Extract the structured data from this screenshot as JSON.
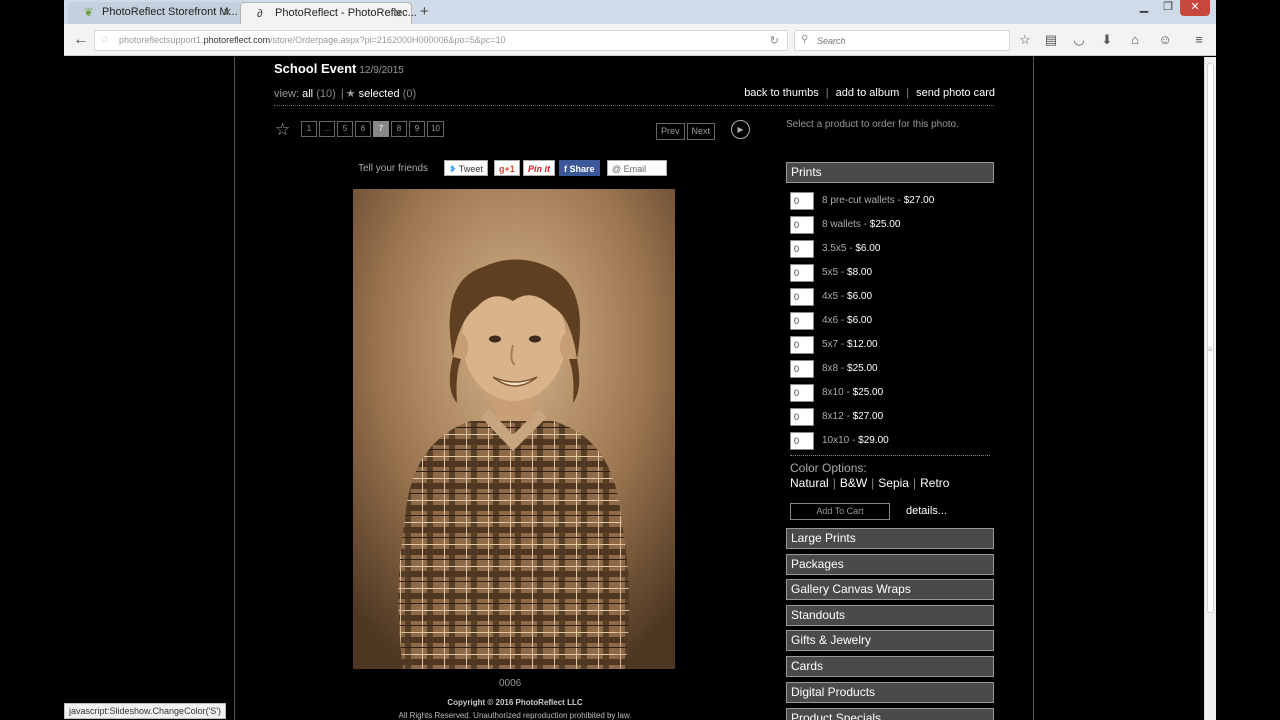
{
  "browser": {
    "tabs": [
      {
        "title": "PhotoReflect Storefront M...",
        "active": false
      },
      {
        "title": "PhotoReflect - PhotoReflec...",
        "active": true
      }
    ],
    "url_prefix": "photoreflectsupport1.",
    "url_domain": "photoreflect.com",
    "url_path": "/store/Orderpage.aspx?pi=2162000H000006&po=5&pc=10",
    "search_placeholder": "Search",
    "status_text": "javascript:Slideshow.ChangeColor('S')"
  },
  "event": {
    "title": "School Event",
    "date": "12/9/2015"
  },
  "view": {
    "label": "view:",
    "all_label": "all",
    "all_count": "(10)",
    "selected_label": "selected",
    "selected_count": "(0)"
  },
  "top_links": {
    "back": "back to thumbs",
    "album": "add to album",
    "card": "send photo card"
  },
  "pager": {
    "pages": [
      "1",
      "...",
      "5",
      "6",
      "7",
      "8",
      "9",
      "10"
    ],
    "current": "7",
    "prev": "Prev",
    "next": "Next"
  },
  "select_message": "Select a product to order for this photo.",
  "share": {
    "tell_label": "Tell your friends",
    "tweet": "Tweet",
    "gplus": "g+1",
    "pin": "Pin it",
    "fb_share": "Share",
    "email": "@ Email"
  },
  "photo": {
    "number": "0006"
  },
  "footer": {
    "copyright": "Copyright © 2016 PhotoReflect LLC",
    "rights": "All Rights Reserved. Unauthorized reproduction prohibited by law."
  },
  "prints": {
    "header": "Prints",
    "items": [
      {
        "qty": "0",
        "name": "8 pre-cut wallets",
        "price": "$27.00"
      },
      {
        "qty": "0",
        "name": "8 wallets",
        "price": "$25.00"
      },
      {
        "qty": "0",
        "name": "3.5x5",
        "price": "$6.00"
      },
      {
        "qty": "0",
        "name": "5x5",
        "price": "$8.00"
      },
      {
        "qty": "0",
        "name": "4x5",
        "price": "$6.00"
      },
      {
        "qty": "0",
        "name": "4x6",
        "price": "$6.00"
      },
      {
        "qty": "0",
        "name": "5x7",
        "price": "$12.00"
      },
      {
        "qty": "0",
        "name": "8x8",
        "price": "$25.00"
      },
      {
        "qty": "0",
        "name": "8x10",
        "price": "$25.00"
      },
      {
        "qty": "0",
        "name": "8x12",
        "price": "$27.00"
      },
      {
        "qty": "0",
        "name": "10x10",
        "price": "$29.00"
      }
    ],
    "color_options_label": "Color Options:",
    "colors": [
      "Natural",
      "B&W",
      "Sepia",
      "Retro"
    ],
    "add_to_cart": "Add To Cart",
    "details": "details..."
  },
  "categories": [
    "Large Prints",
    "Packages",
    "Gallery Canvas Wraps",
    "Standouts",
    "Gifts & Jewelry",
    "Cards",
    "Digital Products",
    "Product Specials"
  ]
}
